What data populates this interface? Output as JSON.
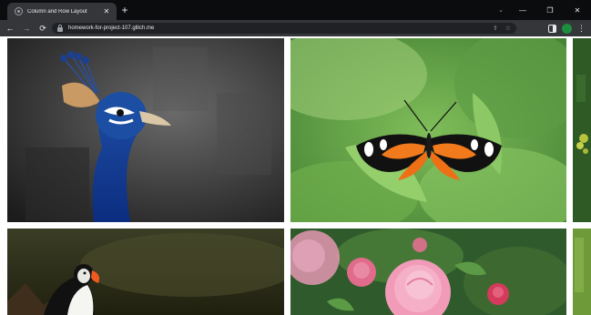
{
  "browser": {
    "tab": {
      "title": "Column and Row Layout",
      "close_icon": "close-icon"
    },
    "new_tab_icon": "plus-icon",
    "window_controls": [
      "chevron-down-icon",
      "minimize-icon",
      "restore-icon",
      "close-icon"
    ],
    "toolbar": {
      "back_icon": "arrow-left-icon",
      "forward_icon": "arrow-right-icon",
      "reload_icon": "reload-icon",
      "url": "homework-for-project-107.glitch.me",
      "share_icon": "share-icon",
      "bookmark_icon": "star-icon",
      "extensions_icon": "extension-panel-icon",
      "profile_initial": "",
      "menu_icon": "vertical-dots-icon"
    }
  },
  "gallery": {
    "images": [
      {
        "subject": "peacock"
      },
      {
        "subject": "butterfly"
      },
      {
        "subject": "leaves"
      },
      {
        "subject": "puffin"
      },
      {
        "subject": "roses"
      },
      {
        "subject": "foliage"
      }
    ]
  },
  "colors": {
    "tab_strip": "#0b0c0e",
    "toolbar": "#35363a",
    "omnibox": "#202124",
    "page_background": "#ffffff"
  }
}
